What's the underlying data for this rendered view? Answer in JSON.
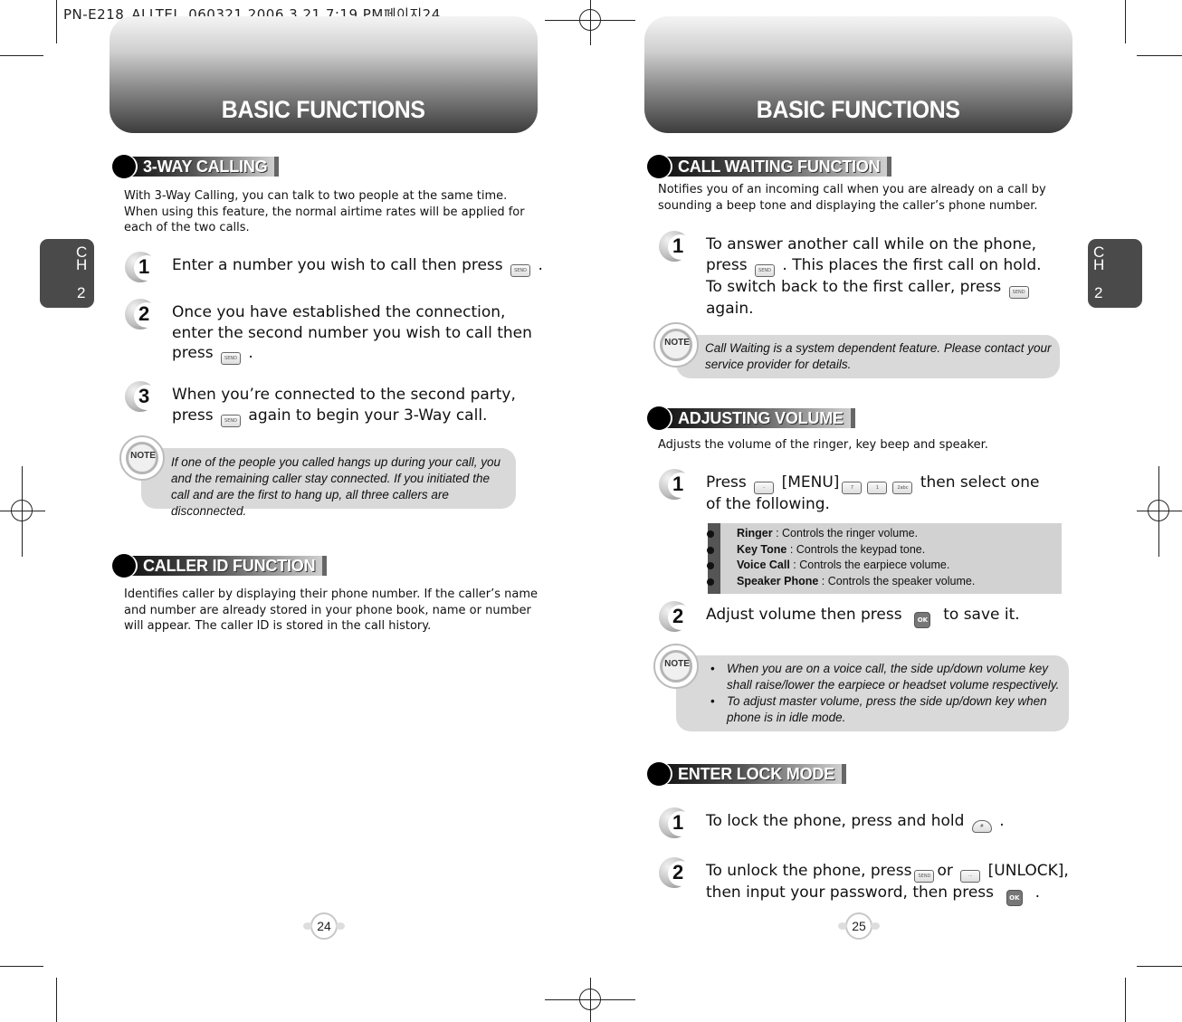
{
  "slug": "PN-E218_ALLTEL_060321  2006.3.21 7:19 PM페이지24",
  "chapter_tab": {
    "letters": "CH",
    "number": "2"
  },
  "left_page": {
    "header": "BASIC FUNCTIONS",
    "page_number": "24",
    "three_way": {
      "title": "3-WAY CALLING",
      "intro": "With 3-Way Calling, you can talk to two people at the same time. When using this feature, the normal airtime rates will be applied for each of the two calls.",
      "steps": [
        {
          "num": "1",
          "parts": [
            "Enter a number you wish to call then press",
            "."
          ]
        },
        {
          "num": "2",
          "line1": "Once you have established the connection,",
          "line2": "enter the second number you wish to call then",
          "line3a": "press",
          "line3b": "."
        },
        {
          "num": "3",
          "line1": "When you’re connected to the second party,",
          "line2a": "press",
          "line2b": "again to begin your 3-Way call."
        }
      ],
      "note": {
        "icon_label": "NOTE",
        "text": "If one of the people you called hangs up during your call, you and the remaining caller stay connected. If you initiated the call and are the first to hang up, all three callers are disconnected."
      }
    },
    "caller_id": {
      "title": "CALLER ID FUNCTION",
      "intro": "Identifies caller by displaying their phone number. If the caller’s name and number are already stored in your phone book, name or number will appear. The caller ID is stored in the call history."
    }
  },
  "right_page": {
    "header": "BASIC FUNCTIONS",
    "page_number": "25",
    "call_waiting": {
      "title": "CALL WAITING FUNCTION",
      "intro": "Notifies you of an incoming call when you are already on a call by sounding a beep tone and displaying the caller’s phone number.",
      "step": {
        "num": "1",
        "line1": "To answer another call while on the phone,",
        "line2a": "press",
        "line2b": ". This places the first call on hold.",
        "line3": "To switch back to the first caller, press",
        "line4": "again."
      },
      "note": {
        "icon_label": "NOTE",
        "text": "Call Waiting is a system dependent feature. Please contact your service provider for details."
      }
    },
    "volume": {
      "title": "ADJUSTING VOLUME",
      "intro": "Adjusts the volume of the ringer, key beep and speaker.",
      "step1": {
        "num": "1",
        "press": "Press",
        "menu": "[MENU]",
        "tail": "then select one",
        "line2": "of the following."
      },
      "options": [
        {
          "name": "Ringer",
          "desc": " : Controls the ringer volume."
        },
        {
          "name": "Key Tone",
          "desc": " : Controls the keypad tone."
        },
        {
          "name": "Voice Call",
          "desc": " : Controls the earpiece volume."
        },
        {
          "name": "Speaker Phone",
          "desc": " : Controls the speaker volume."
        }
      ],
      "step2": {
        "num": "2",
        "a": "Adjust volume then press",
        "b": "to save it."
      },
      "note": {
        "icon_label": "NOTE",
        "items": [
          "When you are on a voice call, the side up/down volume key shall raise/lower the earpiece or headset volume respectively.",
          "To adjust master volume, press the side up/down key when phone is in idle mode."
        ]
      }
    },
    "lock": {
      "title": "ENTER LOCK MODE",
      "step1": {
        "num": "1",
        "a": "To lock the phone, press and hold",
        "b": "."
      },
      "step2": {
        "num": "2",
        "a": "To unlock the phone, press",
        "or": "or",
        "b": "[UNLOCK],",
        "line2a": "then input your password, then press",
        "line2b": "."
      }
    }
  },
  "keys": {
    "send": "SEND",
    "ok": "OK",
    "menu": "··",
    "seven": "7",
    "one": "1",
    "two": "2abc",
    "lock": "#",
    "more": "···"
  }
}
